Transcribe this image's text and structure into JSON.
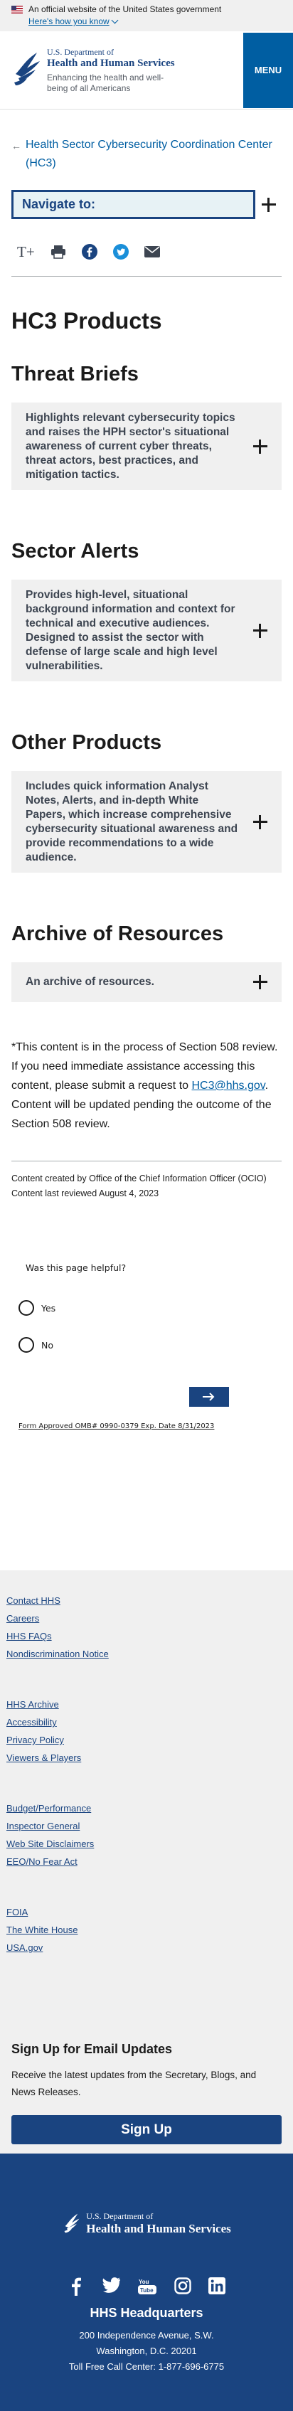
{
  "banner": {
    "official_text": "An official website of the United States government",
    "how_text": "Here's how you know"
  },
  "header": {
    "dept_line1": "U.S. Department of",
    "dept_line2": "Health and Human Services",
    "tagline": "Enhancing the health and well-being of all Americans",
    "menu_label": "MENU"
  },
  "breadcrumb": {
    "label": "Health Sector Cybersecurity Coordination Center (HC3)"
  },
  "navigate": {
    "label": "Navigate to:"
  },
  "tools": {
    "text_size_label": "T+"
  },
  "page": {
    "title": "HC3 Products",
    "sections": [
      {
        "heading": "Threat Briefs",
        "summary": "Highlights relevant cybersecurity topics and raises the HPH sector's situational awareness of current cyber threats, threat actors, best practices, and mitigation tactics."
      },
      {
        "heading": "Sector Alerts",
        "summary": "Provides high-level, situational background information and context for technical and executive audiences. Designed to assist the sector with defense of large scale and high level vulnerabilities."
      },
      {
        "heading": "Other Products",
        "summary": "Includes quick information Analyst Notes, Alerts, and in-depth White Papers, which increase comprehensive cybersecurity situational awareness and provide recommendations to a wide audience."
      },
      {
        "heading": "Archive of Resources",
        "summary": "An archive of resources."
      }
    ],
    "notice_before": "*This content is in the process of Section 508 review. If you need immediate assistance accessing this content, please submit a request to ",
    "notice_link": "HC3@hhs.gov",
    "notice_after": ". Content will be updated pending the outcome of the Section 508 review.",
    "created_by": "Content created by Office of the Chief Information Officer (OCIO)",
    "reviewed": "Content last reviewed August 4, 2023"
  },
  "survey": {
    "question": "Was this page helpful?",
    "yes": "Yes",
    "no": "No",
    "omb": "Form Approved OMB# 0990-0379 Exp. Date 8/31/2023"
  },
  "footer": {
    "group1": [
      "Contact HHS",
      "Careers",
      "HHS FAQs",
      "Nondiscrimination Notice"
    ],
    "group2": [
      "HHS Archive",
      "Accessibility",
      "Privacy Policy",
      "Viewers & Players"
    ],
    "group3": [
      "Budget/Performance",
      "Inspector General",
      "Web Site Disclaimers",
      "EEO/No Fear Act"
    ],
    "group4": [
      "FOIA",
      "The White House",
      "USA.gov"
    ]
  },
  "signup": {
    "heading": "Sign Up for Email Updates",
    "text": "Receive the latest updates from the Secretary, Blogs, and News Releases.",
    "button": "Sign Up"
  },
  "bottom": {
    "dept_line1": "U.S. Department of",
    "dept_line2": "Health and Human Services",
    "hq_title": "HHS Headquarters",
    "address_line1": "200 Independence Avenue, S.W.",
    "address_line2": "Washington, D.C. 20201",
    "toll_free": "Toll Free Call Center: 1-877-696-6775"
  },
  "colors": {
    "primary": "#1a4480",
    "link": "#005ea2",
    "menu": "#005ea2",
    "panel": "#f0f0f0"
  }
}
